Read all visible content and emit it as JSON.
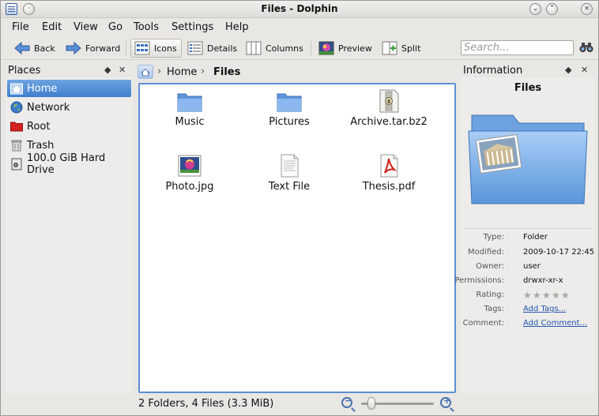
{
  "window": {
    "title": "Files - Dolphin"
  },
  "menu": [
    "File",
    "Edit",
    "View",
    "Go",
    "Tools",
    "Settings",
    "Help"
  ],
  "toolbar": {
    "back": "Back",
    "forward": "Forward",
    "icons": "Icons",
    "details": "Details",
    "columns": "Columns",
    "preview": "Preview",
    "split": "Split",
    "search_placeholder": "Search..."
  },
  "places": {
    "title": "Places",
    "items": [
      {
        "label": "Home",
        "icon": "home-icon",
        "selected": true
      },
      {
        "label": "Network",
        "icon": "globe-icon"
      },
      {
        "label": "Root",
        "icon": "red-folder-icon"
      },
      {
        "label": "Trash",
        "icon": "trash-icon"
      },
      {
        "label": "100.0 GiB Hard Drive",
        "icon": "drive-icon"
      }
    ]
  },
  "breadcrumb": {
    "home": "Home",
    "current": "Files"
  },
  "files": [
    {
      "name": "Music",
      "icon": "folder-icon"
    },
    {
      "name": "Pictures",
      "icon": "folder-icon"
    },
    {
      "name": "Archive.tar.bz2",
      "icon": "archive-icon"
    },
    {
      "name": "Photo.jpg",
      "icon": "image-icon"
    },
    {
      "name": "Text File",
      "icon": "text-file-icon"
    },
    {
      "name": "Thesis.pdf",
      "icon": "pdf-icon"
    }
  ],
  "info": {
    "title": "Information",
    "name": "Files",
    "rows": [
      {
        "key": "Type:",
        "value": "Folder"
      },
      {
        "key": "Modified:",
        "value": "2009-10-17 22:45"
      },
      {
        "key": "Owner:",
        "value": "user"
      },
      {
        "key": "Permissions:",
        "value": "drwxr-xr-x"
      },
      {
        "key": "Rating:",
        "value": ""
      },
      {
        "key": "Tags:",
        "value": "Add Tags..."
      },
      {
        "key": "Comment:",
        "value": "Add Comment..."
      }
    ],
    "rating_stars": 0
  },
  "status": {
    "text": "2 Folders, 4 Files (3.3 MiB)",
    "zoom_level": 0.1
  },
  "colors": {
    "accent": "#3f7fcf",
    "folder": "#6fa3e0",
    "link": "#2455b0"
  }
}
